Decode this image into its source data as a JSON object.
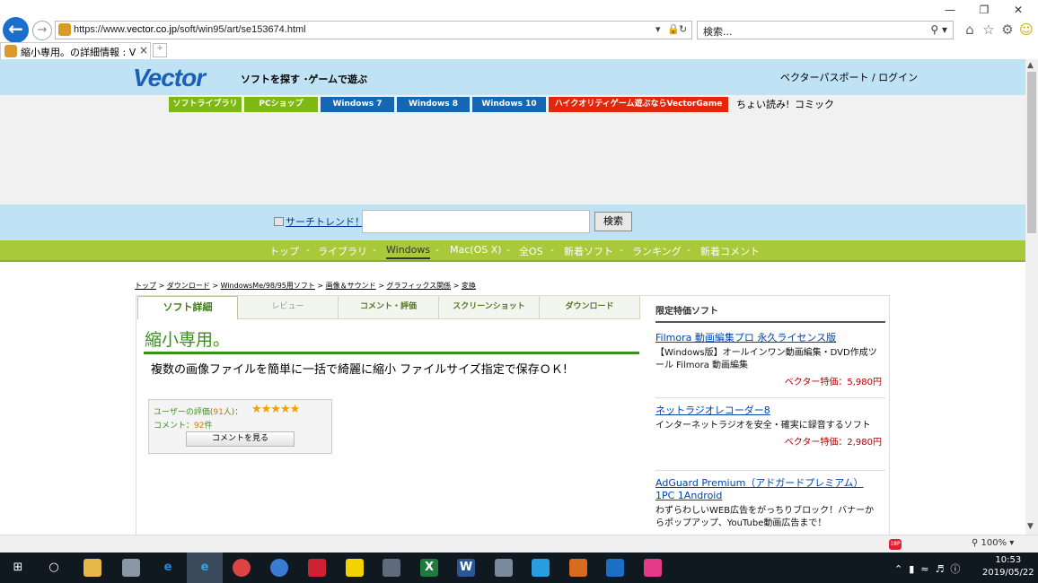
{
  "browser": {
    "url_prefix": "https://www.",
    "url_host": "vector.co.jp",
    "url_path": "/soft/win95/art/se153674.html",
    "search_placeholder": "検索...",
    "tab_title": "縮小専用。の詳細情報 : Vect...",
    "window_controls": [
      "—",
      "❐",
      "✕"
    ],
    "icons": [
      "home-icon",
      "star-icon",
      "gear-icon",
      "smiley-icon"
    ]
  },
  "header": {
    "logo": "Vector",
    "tagline": "ソフトを探す ･ゲームで遊ぶ",
    "login": "ベクターパスポート / ログイン"
  },
  "nav": {
    "buttons": [
      {
        "label": "ソフトライブラリ",
        "color": "#7db913"
      },
      {
        "label": "PCショップ",
        "color": "#7db913"
      },
      {
        "label": "Windows 7",
        "color": "#1467b3"
      },
      {
        "label": "Windows 8",
        "color": "#1467b3"
      },
      {
        "label": "Windows 10",
        "color": "#1467b3"
      },
      {
        "label": "ハイクオリティゲーム遊ぶならVectorGame",
        "color": "#e3260c"
      }
    ],
    "text_links": [
      "ちょい読み!",
      "コミック"
    ]
  },
  "search": {
    "trend": "サーチトレンド！",
    "button": "検索"
  },
  "gnav": {
    "items": [
      "トップ",
      "ライブラリ",
      "Windows",
      "Mac(OS X)",
      "全OS",
      "新着ソフト",
      "ランキング",
      "新着コメント"
    ],
    "active": "Windows"
  },
  "breadcrumb": [
    "トップ",
    "ダウンロード",
    "WindowsMe/98/95用ソフト",
    "画像＆サウンド",
    "グラフィックス関係",
    "変換"
  ],
  "detail": {
    "tabs": [
      "ソフト詳細",
      "レビュー",
      "コメント・評価",
      "スクリーンショット",
      "ダウンロード"
    ],
    "title": "縮小専用。",
    "catch": "複数の画像ファイルを簡単に一括で綺麗に縮小 ファイルサイズ指定で保存ＯＫ!",
    "rating_label_pre": "ユーザーの評価(",
    "rating_count": "91",
    "rating_label_post": "人)：",
    "stars": "★★★★★",
    "comment_label": "コメント：",
    "comment_count": "92",
    "comment_unit": "件",
    "comment_button": "コメントを見る"
  },
  "sidebar": {
    "heading": "限定特価ソフト",
    "items": [
      {
        "title": "Filmora 動画編集プロ 永久ライセンス版",
        "desc": "【Windows版】オールインワン動画編集・DVD作成ツール Filmora 動画編集",
        "price": "ベクター特価：5,980円"
      },
      {
        "title": "ネットラジオレコーダー8",
        "desc": "インターネットラジオを安全・確実に録音するソフト",
        "price": "ベクター特価：2,980円"
      },
      {
        "title": "AdGuard Premium（アドガードプレミアム） 1PC 1Android",
        "desc": "わずらわしいWEB広告をがっちりブロック！バナーからポップアップ、YouTube動画広告まで！",
        "price": ""
      }
    ]
  },
  "status": {
    "zoom": "100%"
  },
  "taskbar": {
    "time": "10:53",
    "date": "2019/05/22"
  }
}
